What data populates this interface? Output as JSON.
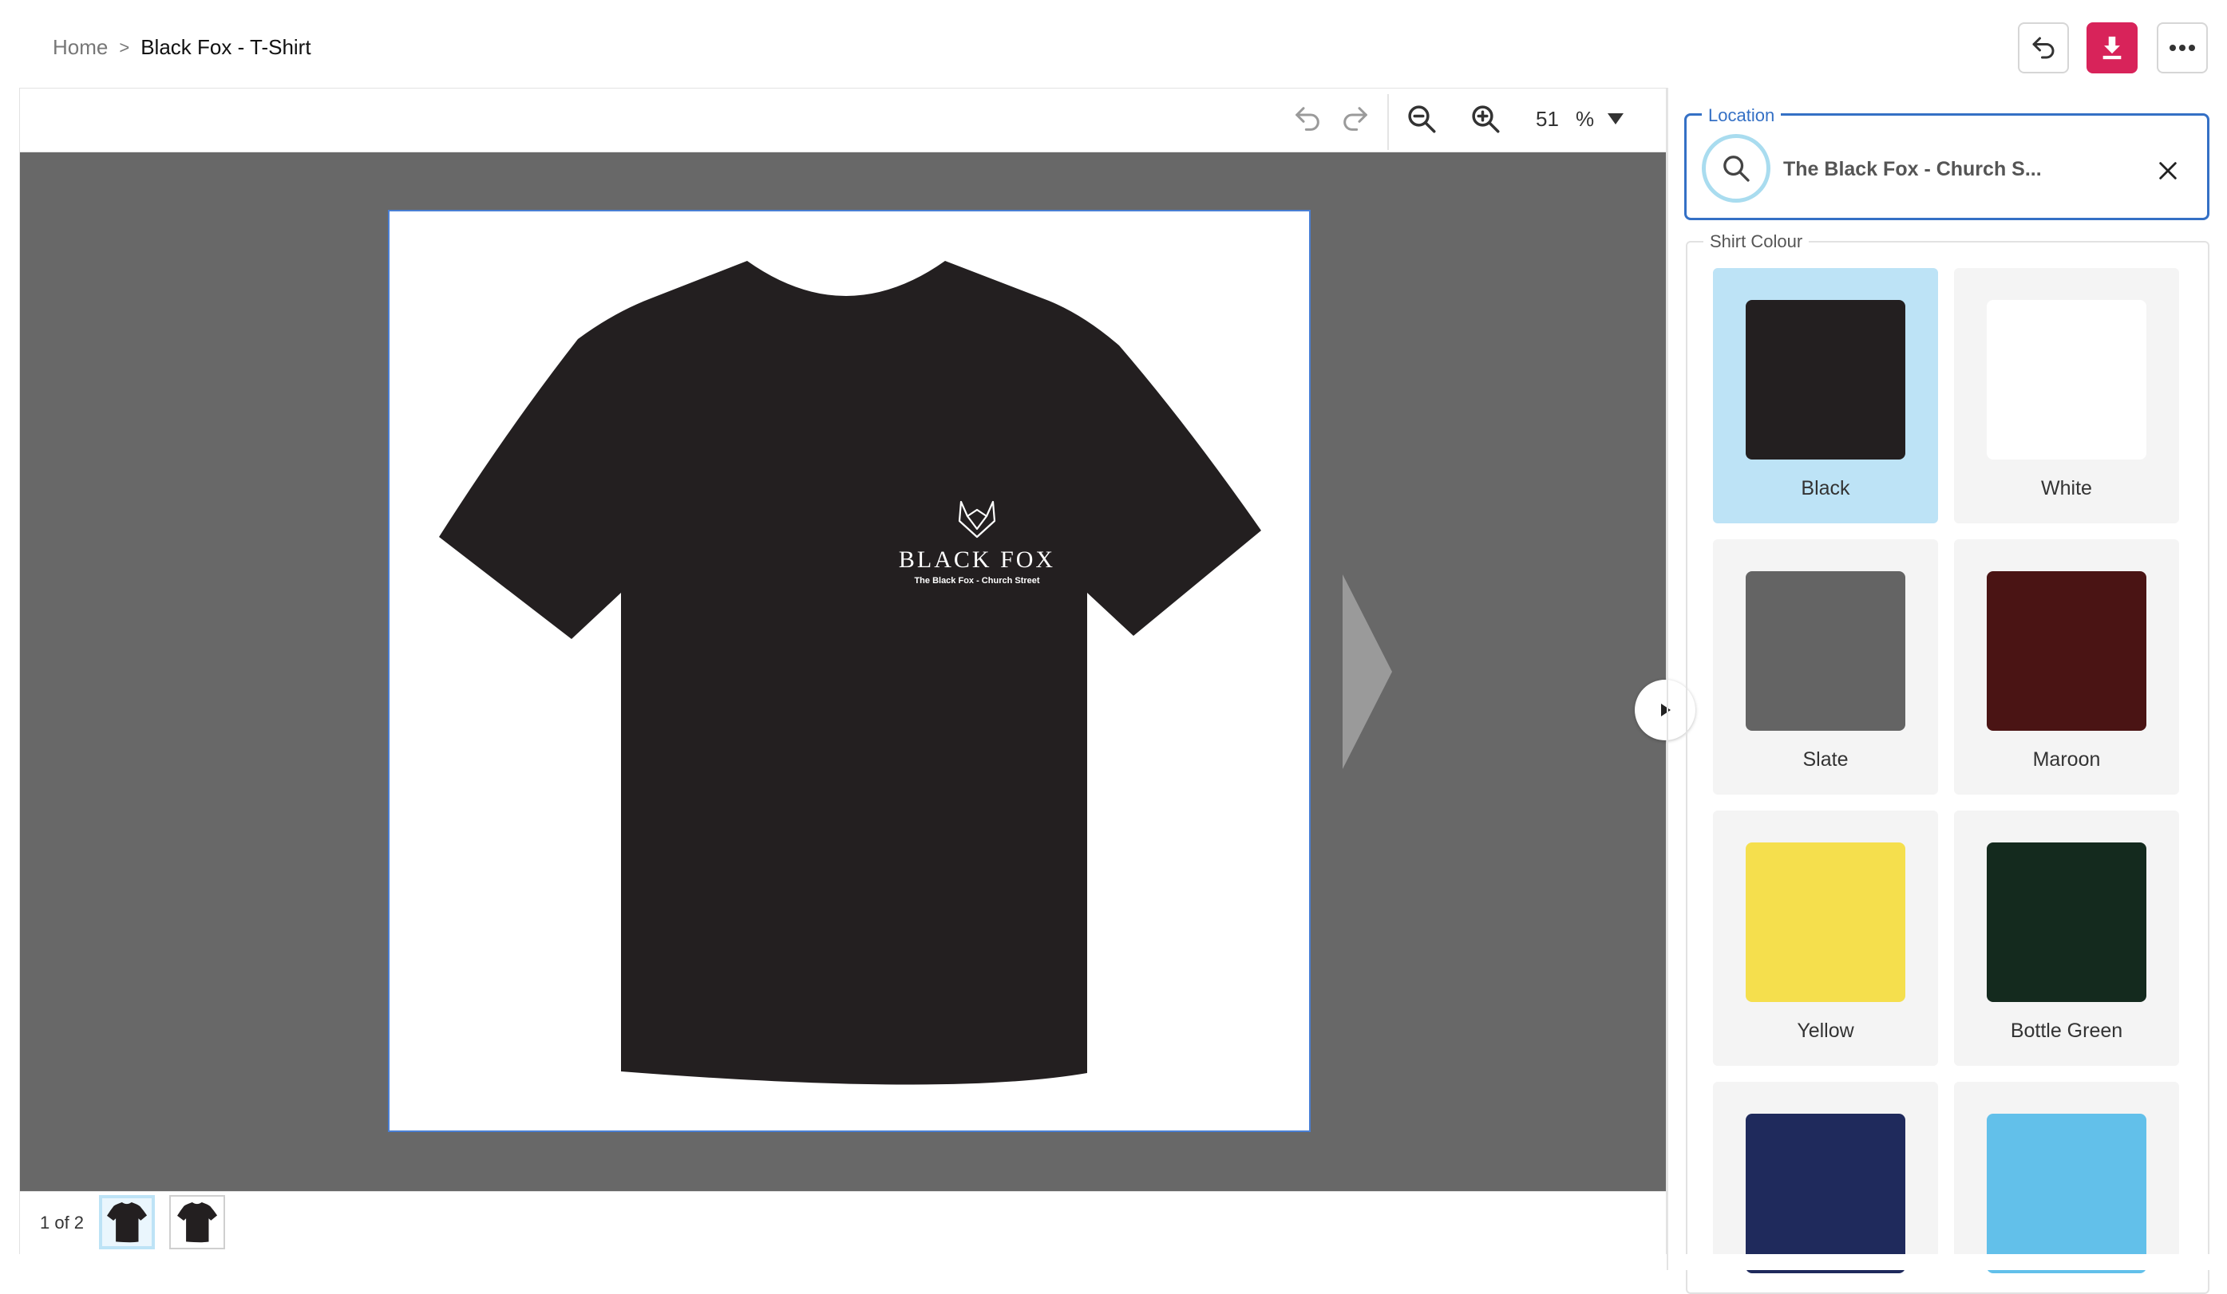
{
  "breadcrumb": {
    "home": "Home",
    "separator": ">",
    "current": "Black Fox - T-Shirt"
  },
  "header_actions": {
    "undo_icon": "undo-arrow-icon",
    "download_icon": "download-icon",
    "more_icon": "more-dots-icon",
    "accent_color": "#d8235a"
  },
  "toolbar": {
    "zoom_value": "51",
    "zoom_unit": "%"
  },
  "artboard": {
    "shirt_color": "#231f20",
    "logo_title": "BLACK FOX",
    "logo_subtitle": "The Black Fox - Church Street"
  },
  "pages": {
    "counter": "1 of 2",
    "thumbnails": [
      "page-1",
      "page-2"
    ]
  },
  "location": {
    "label": "Location",
    "value": "The Black Fox - Church S..."
  },
  "shirt_colour": {
    "label": "Shirt Colour",
    "selected": "Black",
    "options": [
      {
        "name": "Black",
        "hex": "#231f20"
      },
      {
        "name": "White",
        "hex": "#ffffff"
      },
      {
        "name": "Slate",
        "hex": "#646464"
      },
      {
        "name": "Maroon",
        "hex": "#4a1414"
      },
      {
        "name": "Yellow",
        "hex": "#f5df4d"
      },
      {
        "name": "Bottle Green",
        "hex": "#142a1e"
      },
      {
        "name": "",
        "hex": "#1f2a5c"
      },
      {
        "name": "",
        "hex": "#62c0ea"
      }
    ]
  }
}
